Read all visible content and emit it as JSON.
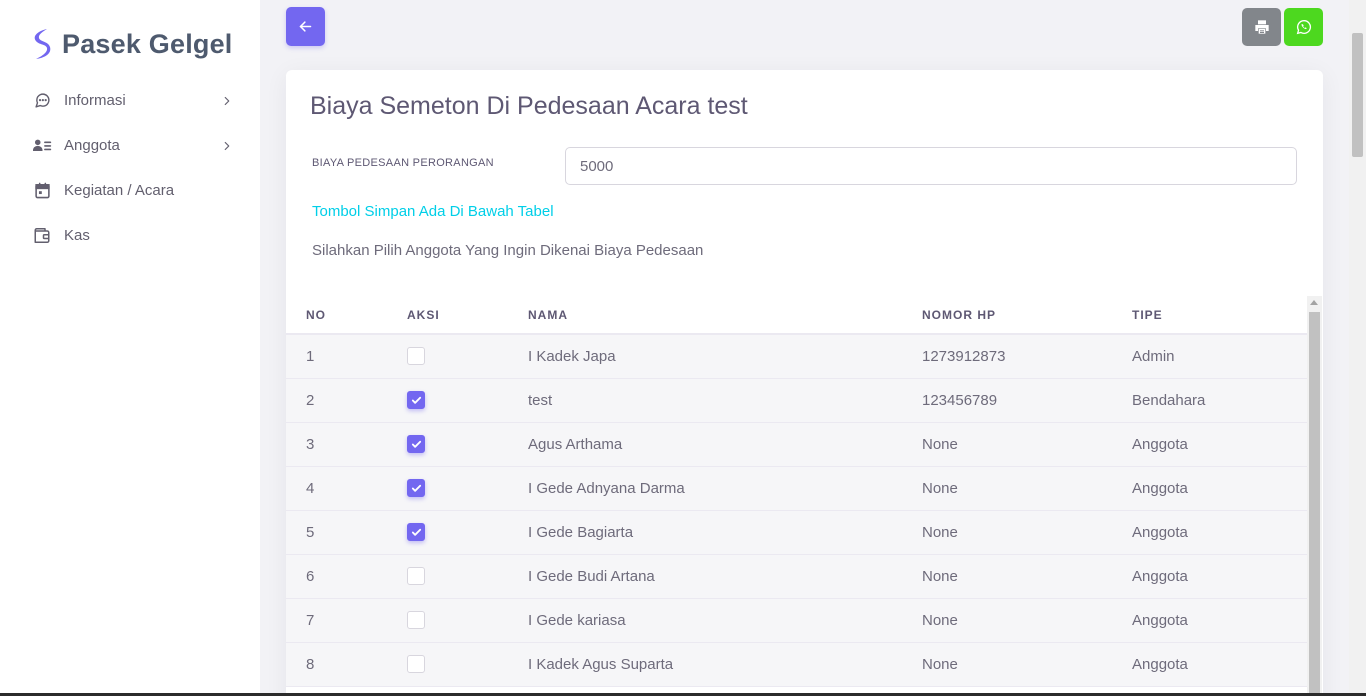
{
  "brand": {
    "name": "Pasek Gelgel",
    "color": "#7367f0"
  },
  "sidebar": {
    "items": [
      {
        "label": "Informasi",
        "icon": "message-circle-icon",
        "has_submenu": true
      },
      {
        "label": "Anggota",
        "icon": "user-list-icon",
        "has_submenu": true
      },
      {
        "label": "Kegiatan / Acara",
        "icon": "calendar-icon",
        "has_submenu": false
      },
      {
        "label": "Kas",
        "icon": "wallet-icon",
        "has_submenu": false
      }
    ]
  },
  "toolbar": {
    "back_icon": "arrow-left-icon",
    "print_icon": "printer-icon",
    "whatsapp_icon": "whatsapp-icon",
    "colors": {
      "primary": "#7367f0",
      "secondary": "#82868b",
      "whatsapp": "#4dd81f"
    }
  },
  "card": {
    "title": "Biaya Semeton Di Pedesaan Acara test",
    "field_label": "BIAYA PEDESAAN PERORANGAN",
    "field_value": "5000",
    "info_link": "Tombol Simpan Ada Di Bawah Tabel",
    "info_text": "Silahkan Pilih Anggota Yang Ingin Dikenai Biaya Pedesaan"
  },
  "table": {
    "headers": {
      "no": "NO",
      "aksi": "AKSI",
      "nama": "NAMA",
      "hp": "NOMOR HP",
      "tipe": "TIPE"
    },
    "rows": [
      {
        "no": "1",
        "checked": false,
        "nama": "I Kadek Japa",
        "hp": "1273912873",
        "tipe": "Admin"
      },
      {
        "no": "2",
        "checked": true,
        "nama": "test",
        "hp": "123456789",
        "tipe": "Bendahara"
      },
      {
        "no": "3",
        "checked": true,
        "nama": "Agus Arthama",
        "hp": "None",
        "tipe": "Anggota"
      },
      {
        "no": "4",
        "checked": true,
        "nama": "I Gede Adnyana Darma",
        "hp": "None",
        "tipe": "Anggota"
      },
      {
        "no": "5",
        "checked": true,
        "nama": "I Gede Bagiarta",
        "hp": "None",
        "tipe": "Anggota"
      },
      {
        "no": "6",
        "checked": false,
        "nama": "I Gede Budi Artana",
        "hp": "None",
        "tipe": "Anggota"
      },
      {
        "no": "7",
        "checked": false,
        "nama": "I Gede kariasa",
        "hp": "None",
        "tipe": "Anggota"
      },
      {
        "no": "8",
        "checked": false,
        "nama": "I Kadek Agus Suparta",
        "hp": "None",
        "tipe": "Anggota"
      }
    ]
  }
}
